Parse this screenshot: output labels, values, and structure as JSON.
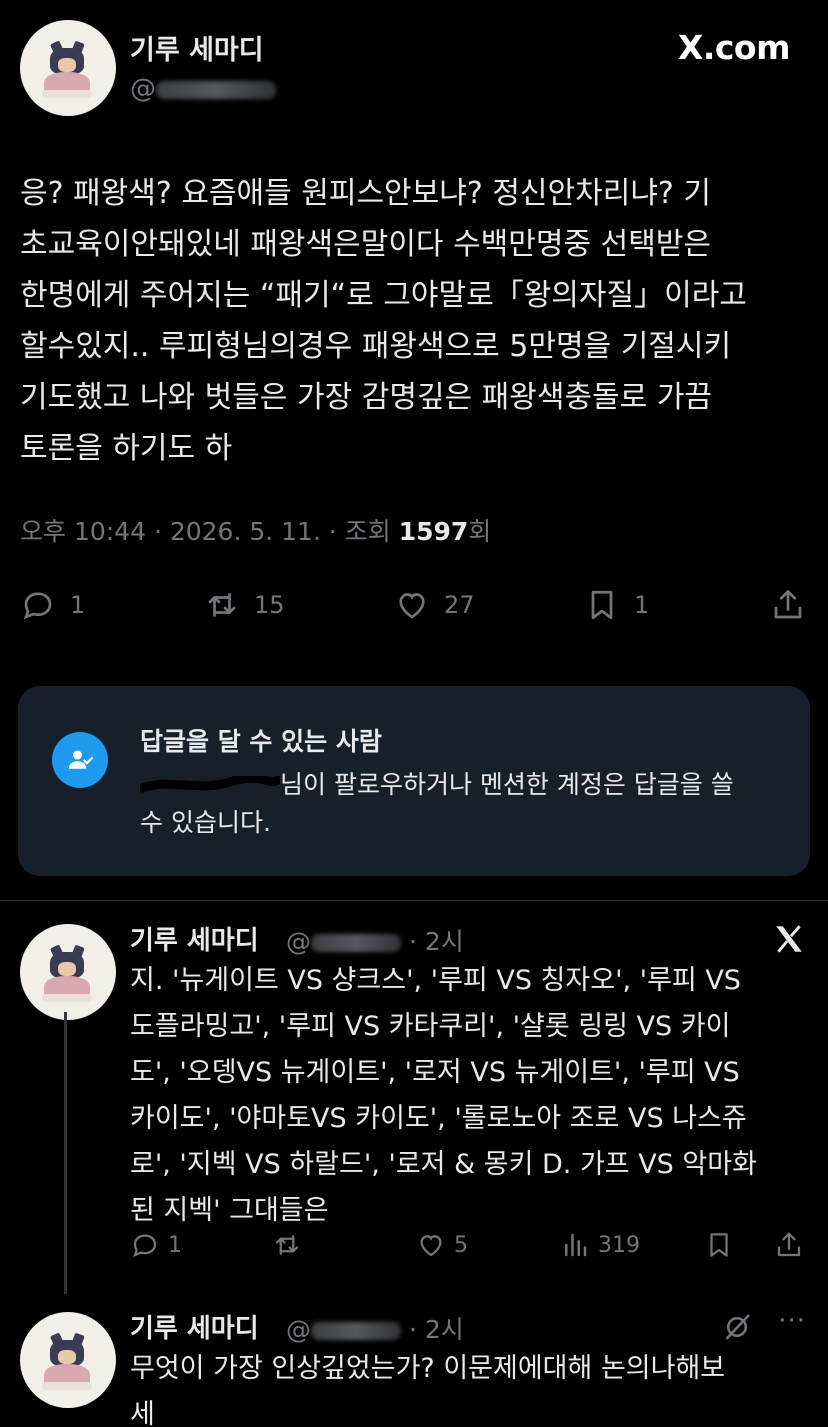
{
  "header": {
    "name": "기루 세마디",
    "handle_prefix": "@",
    "brand": "X.com"
  },
  "tweet": {
    "lines": [
      "응? 패왕색? 요즘애들 원피스안보냐? 정신안차리냐? 기",
      "초교육이안돼있네 패왕색은말이다 수백만명중 선택받은",
      "한명에게 주어지는 “패기“로 그야말로「왕의자질」이라고",
      "할수있지.. 루피형님의경우 패왕색으로 5만명을 기절시키",
      "기도했고 나와 벗들은 가장 감명깊은 패왕색충돌로 가끔",
      "토론을 하기도 하"
    ],
    "time": "오후 10:44 · 2026. 5. 11. · 조회 ",
    "views": "1597",
    "views_suffix": "회",
    "stats": {
      "replies": "1",
      "retweets": "15",
      "likes": "27",
      "bookmarks": "1"
    }
  },
  "reply_notice": {
    "title": "답글을 달 수 있는 사람",
    "line1_suffix": "님이 팔로우하거나 멘션한 계정은 답글을 쓸",
    "line2": "수 있습니다."
  },
  "reply1": {
    "name": "기루 세마디",
    "handle": "@",
    "age": "· 2시",
    "lines": [
      "지.  '뉴게이트 VS 샹크스', '루피 VS 칭자오', '루피 VS",
      "도플라밍고', '루피 VS 카타쿠리', '샬롯 링링 VS 카이",
      "도', '오뎅VS 뉴게이트', '로저 VS 뉴게이트', '루피 VS",
      "카이도', '야마토VS 카이도', '롤로노아 조로 VS 나스쥬",
      "로', '지벡 VS 하랄드', '로저 & 몽키 D. 가프 VS 악마화",
      "된 지벡' 그대들은"
    ],
    "stats": {
      "replies": "1",
      "likes": "5",
      "views": "319"
    }
  },
  "reply2": {
    "name": "기루 세마디",
    "handle": "@",
    "age": "· 2시",
    "more": "···",
    "lines": [
      "무엇이 가장 인상깊었는가? 이문제에대해 논의나해보",
      "세"
    ]
  }
}
